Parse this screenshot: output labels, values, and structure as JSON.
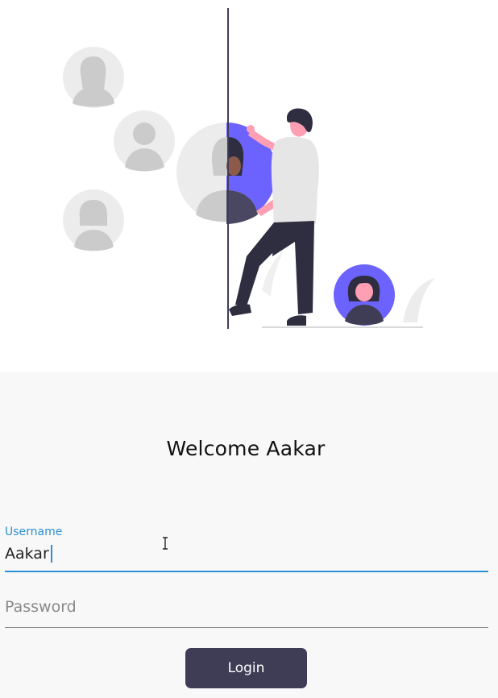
{
  "welcome": {
    "title": "Welcome Aakar"
  },
  "username": {
    "label": "Username",
    "value": "Aakar"
  },
  "password": {
    "placeholder": "Password"
  },
  "login": {
    "label": "Login"
  },
  "colors": {
    "accent": "#2d8fd5",
    "button": "#3f3d56",
    "illustration_purple": "#6c63ff",
    "avatar_gray": "#e6e6e6"
  },
  "illustration": {
    "name": "user-selection-illustration"
  }
}
